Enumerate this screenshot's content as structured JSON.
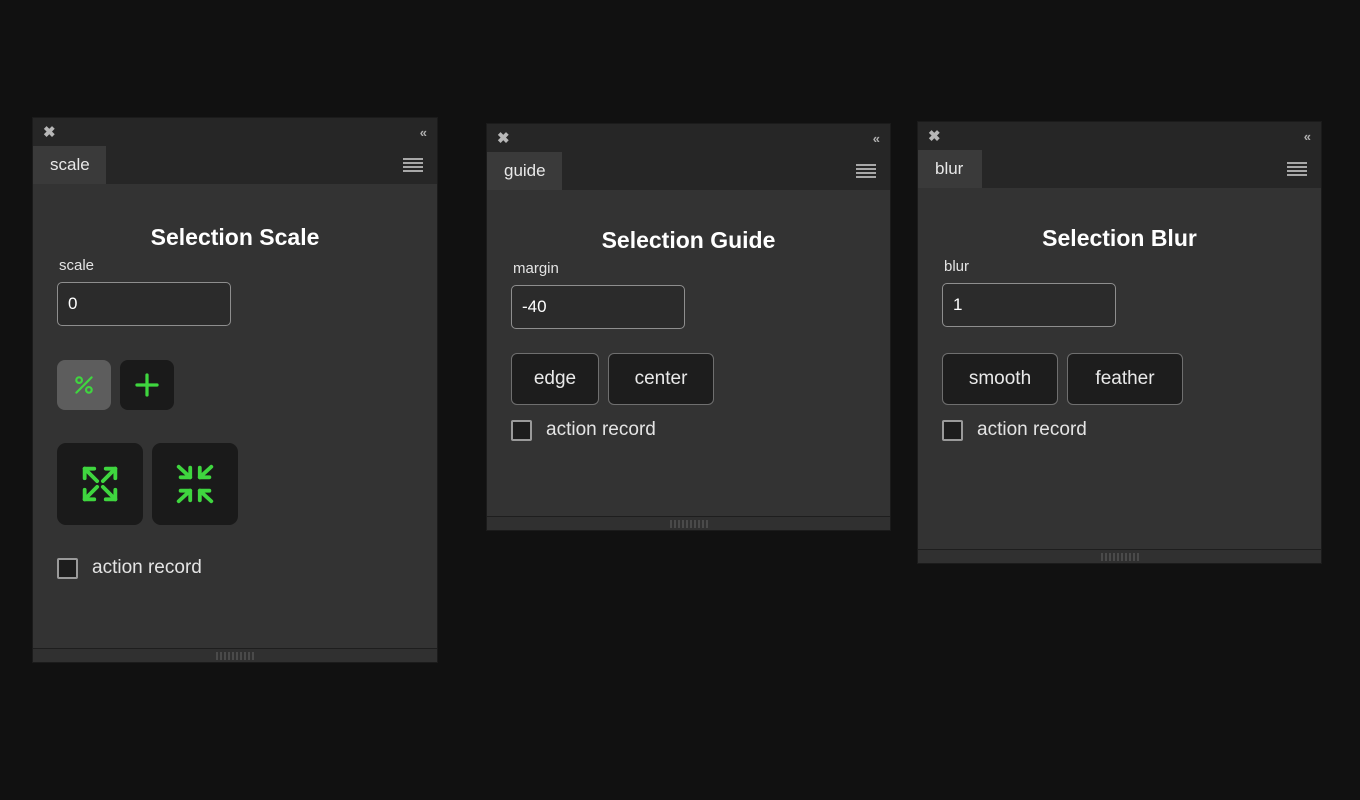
{
  "background_color": "#111111",
  "accent_green": "#3fd63f",
  "panel_bg": "#333333",
  "titlebar_bg": "#262626",
  "common": {
    "close_icon": "✖",
    "collapse_icon": "«",
    "menu_icon": "hamburger",
    "action_record_label": "action record"
  },
  "panels": [
    {
      "tab_label": "scale",
      "title": "Selection Scale",
      "field_label": "scale",
      "field_value": "0",
      "mode_buttons": [
        {
          "name": "percent",
          "glyph": "%",
          "selected": true
        },
        {
          "name": "plus",
          "glyph": "+",
          "selected": false
        }
      ],
      "action_buttons": [
        {
          "name": "expand",
          "glyph": "expand-arrows"
        },
        {
          "name": "contract",
          "glyph": "contract-arrows"
        }
      ],
      "action_record_checked": false
    },
    {
      "tab_label": "guide",
      "title": "Selection Guide",
      "field_label": "margin",
      "field_value": "-40",
      "text_buttons": [
        {
          "name": "edge",
          "label": "edge"
        },
        {
          "name": "center",
          "label": "center"
        }
      ],
      "action_record_checked": false
    },
    {
      "tab_label": "blur",
      "title": "Selection Blur",
      "field_label": "blur",
      "field_value": "1",
      "text_buttons": [
        {
          "name": "smooth",
          "label": "smooth"
        },
        {
          "name": "feather",
          "label": "feather"
        }
      ],
      "action_record_checked": false
    }
  ]
}
